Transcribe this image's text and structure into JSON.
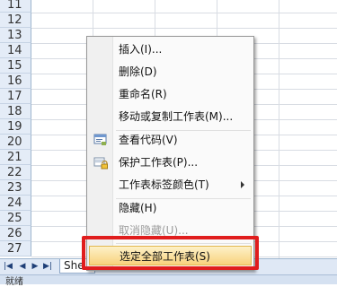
{
  "row_headers": [
    "11",
    "12",
    "13",
    "14",
    "15",
    "16",
    "17",
    "18",
    "19",
    "20",
    "21",
    "22",
    "23",
    "24",
    "25",
    "26",
    "27"
  ],
  "sheet_tab": {
    "label": "She"
  },
  "status": {
    "text": "就绪"
  },
  "context_menu": {
    "items": [
      {
        "label": "插入(I)...",
        "icon": "",
        "disabled": false
      },
      {
        "label": "删除(D)",
        "icon": "",
        "disabled": false
      },
      {
        "label": "重命名(R)",
        "icon": "",
        "disabled": false
      },
      {
        "label": "移动或复制工作表(M)...",
        "icon": "",
        "disabled": false
      },
      {
        "label": "查看代码(V)",
        "icon": "view-code-icon",
        "disabled": false
      },
      {
        "label": "保护工作表(P)...",
        "icon": "protect-sheet-icon",
        "disabled": false
      },
      {
        "label": "工作表标签颜色(T)",
        "icon": "",
        "disabled": false,
        "submenu": true
      },
      {
        "label": "隐藏(H)",
        "icon": "",
        "disabled": false
      },
      {
        "label": "取消隐藏(U)...",
        "icon": "",
        "disabled": true
      },
      {
        "label": "选定全部工作表(S)",
        "icon": "",
        "disabled": false,
        "selected": true
      }
    ]
  },
  "colors": {
    "highlight": "#e01d1d",
    "selected_item": "#f8d27d"
  }
}
